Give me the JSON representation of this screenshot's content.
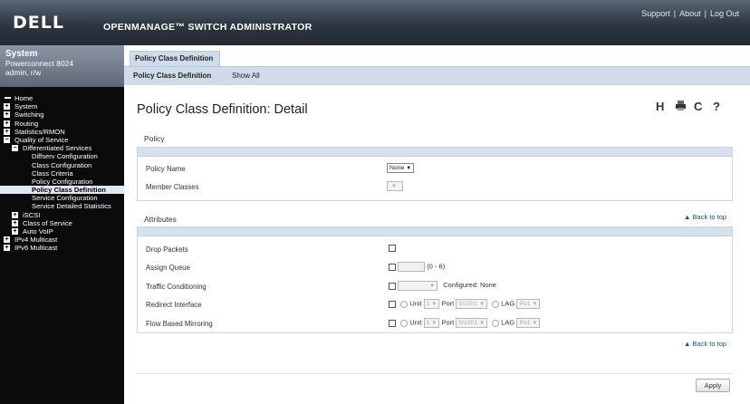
{
  "header": {
    "logo": "DELL",
    "app_title": "OPENMANAGE™ SWITCH ADMINISTRATOR",
    "links": [
      "Support",
      "About",
      "Log Out"
    ]
  },
  "system": {
    "title": "System",
    "model": "Powerconnect 8024",
    "user": "admin, r/w"
  },
  "nav": {
    "home": "Home",
    "system": "System",
    "switching": "Switching",
    "routing": "Routing",
    "statistics": "Statistics/RMON",
    "qos": "Quality of Service",
    "diffserv": "Differentiated Services",
    "diffserv_config": "Diffserv Configuration",
    "class_config": "Class Configuration",
    "class_criteria": "Class Criteria",
    "policy_config": "Policy Configuration",
    "policy_class_def": "Policy Class Definition",
    "service_config": "Service Configuration",
    "service_detailed": "Service Detailed Statistics",
    "iscsi": "iSCSI",
    "cos": "Class of Service",
    "auto_voip": "Auto VoIP",
    "ipv4_multicast": "IPv4 Multicast",
    "ipv6_multicast": "IPv6 Multicast"
  },
  "tabs": {
    "main": "Policy Class Definition",
    "sub": [
      "Policy Class Definition",
      "Show All"
    ]
  },
  "page": {
    "title": "Policy Class Definition: Detail",
    "toolbar_icons": [
      "help-h-icon",
      "print-icon",
      "refresh-icon",
      "question-icon"
    ],
    "policy_section": "Policy",
    "policy_name_label": "Policy Name",
    "policy_name_value": "None",
    "member_classes_label": "Member Classes",
    "attributes_section": "Attributes",
    "back_to_top": "Back to top",
    "drop_packets_label": "Drop Packets",
    "assign_queue_label": "Assign Queue",
    "assign_queue_range": "(0 - 6)",
    "traffic_conditioning_label": "Traffic Conditioning",
    "configured_label": "Configured: None",
    "redirect_interface_label": "Redirect Interface",
    "flow_mirroring_label": "Flow Based Mirroring",
    "unit_label": "Unit",
    "unit_value": "1",
    "port_label": "Port",
    "port_value": "0/1/0/1",
    "lag_label": "LAG",
    "lag_value": "Po1",
    "apply_label": "Apply"
  },
  "colors": {
    "header_dark": "#232a33",
    "sidebar_bg": "#0b0b0b",
    "tab_blue": "#cfdbe9",
    "link_blue": "#1a4f8f"
  }
}
